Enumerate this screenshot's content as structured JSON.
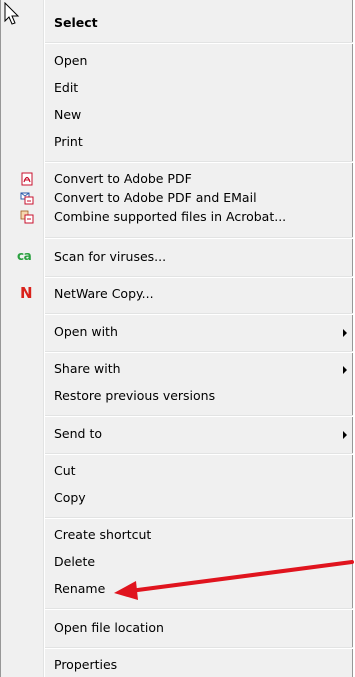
{
  "menu": {
    "select": "Select",
    "open": "Open",
    "edit": "Edit",
    "new": "New",
    "print": "Print",
    "convert_pdf": "Convert to Adobe PDF",
    "convert_pdf_email": "Convert to Adobe PDF and EMail",
    "combine": "Combine supported files in Acrobat...",
    "scan": "Scan for viruses...",
    "netware": "NetWare Copy...",
    "open_with": "Open with",
    "share_with": "Share with",
    "restore": "Restore previous versions",
    "send_to": "Send to",
    "cut": "Cut",
    "copy": "Copy",
    "create_shortcut": "Create shortcut",
    "delete": "Delete",
    "rename": "Rename",
    "open_location": "Open file location",
    "properties": "Properties"
  },
  "icons": {
    "scan_icon_text": "ca",
    "netware_icon_text": "N"
  },
  "colors": {
    "annotation_arrow": "#e0141e",
    "menu_bg": "#f0f0f0",
    "pdf_red": "#c8102e",
    "ca_green": "#2aa140",
    "netware_red": "#d9221b"
  }
}
